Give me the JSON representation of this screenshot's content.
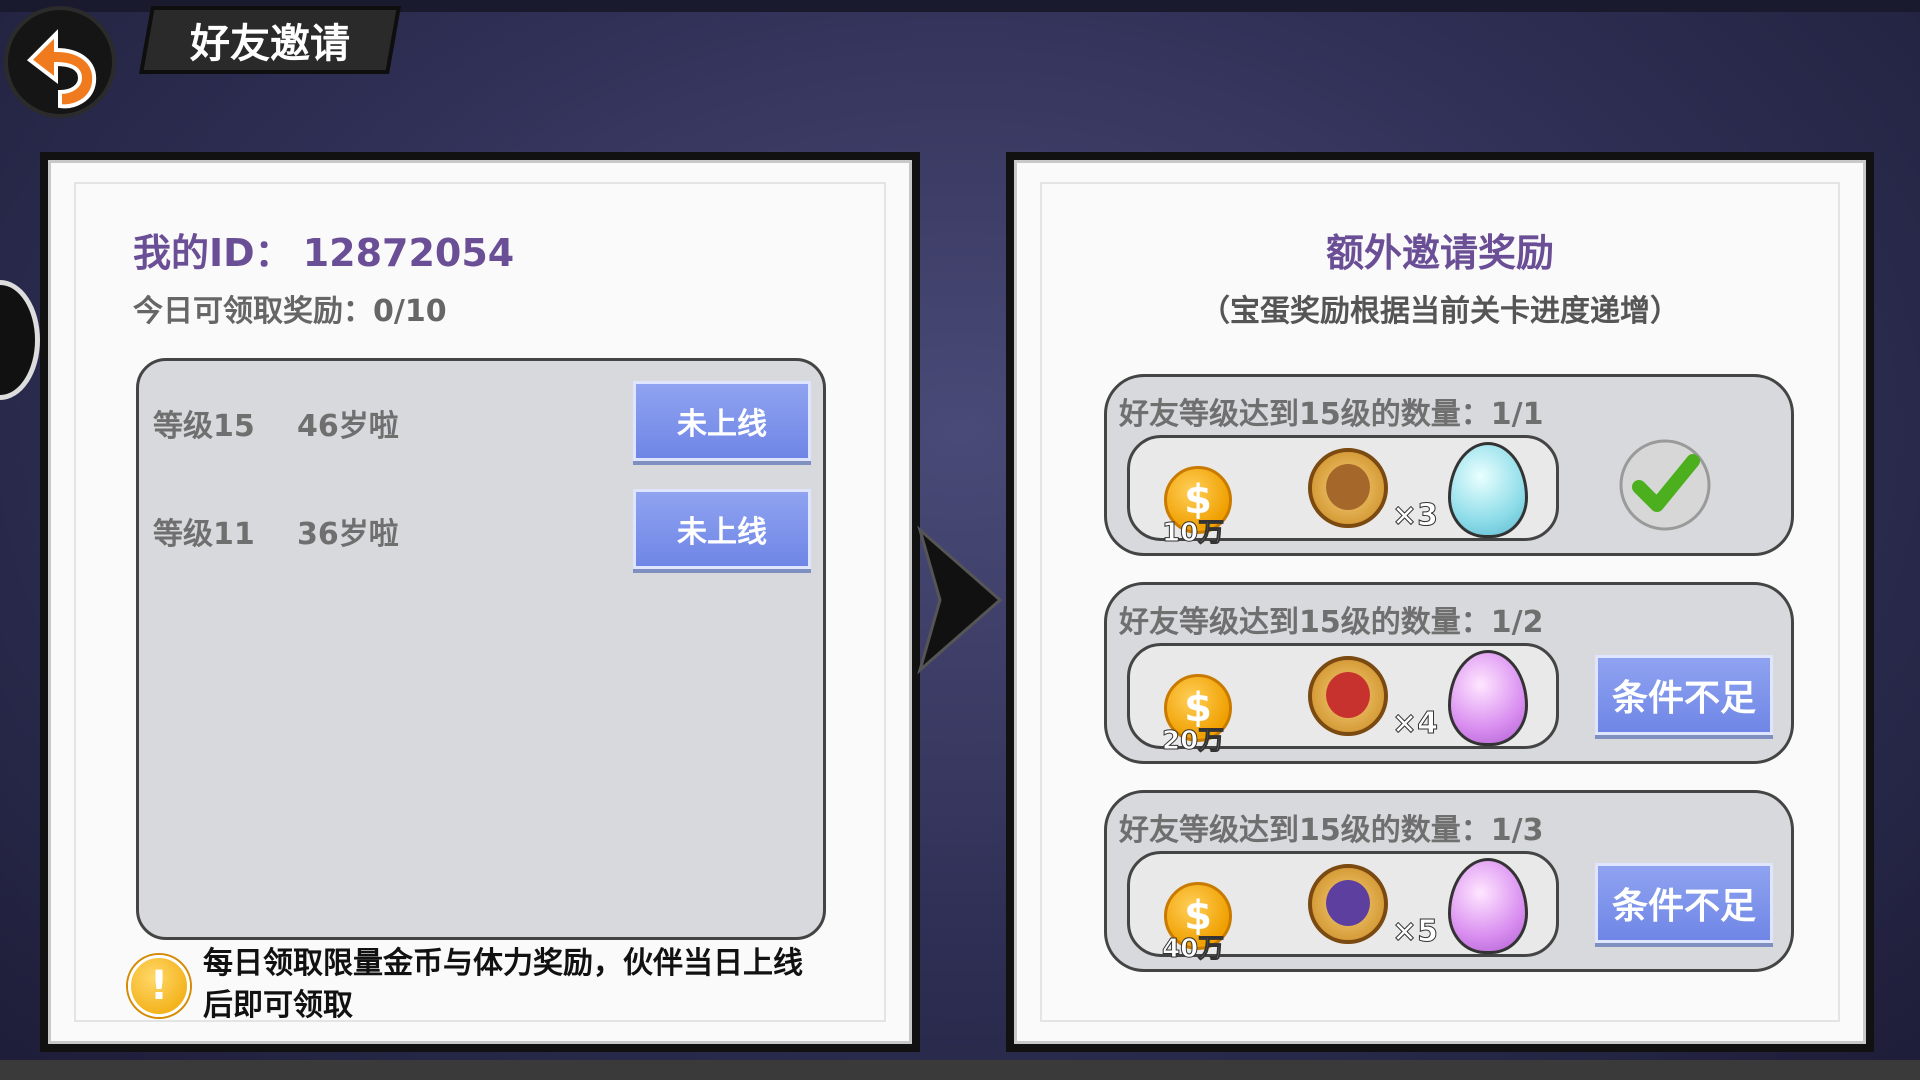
{
  "header": {
    "title": "好友邀请"
  },
  "left_panel": {
    "my_id_label": "我的ID：",
    "my_id_value": "12872054",
    "daily_reward": "今日可领取奖励：0/10",
    "friends": [
      {
        "level": "等级15",
        "name": "46岁啦",
        "status": "未上线"
      },
      {
        "level": "等级11",
        "name": "36岁啦",
        "status": "未上线"
      }
    ],
    "tip_symbol": "!",
    "tip_text": "每日领取限量金币与体力奖励，伙伴当日上线后即可领取"
  },
  "right_panel": {
    "title": "额外邀请奖励",
    "subtitle": "（宝蛋奖励根据当前关卡进度递增）",
    "coin_symbol": "$",
    "rewards": [
      {
        "condition": "好友等级达到15级的数量：1/1",
        "coins": "10万",
        "hero_qty": "×3",
        "egg": "blue",
        "state": "completed"
      },
      {
        "condition": "好友等级达到15级的数量：1/2",
        "coins": "20万",
        "hero_qty": "×4",
        "egg": "purple",
        "state": "条件不足"
      },
      {
        "condition": "好友等级达到15级的数量：1/3",
        "coins": "40万",
        "hero_qty": "×5",
        "egg": "purple",
        "state": "条件不足"
      }
    ]
  },
  "colors": {
    "title_purple": "#6a4e96",
    "button_blue": "#7b90ea",
    "coin_gold": "#f0a000",
    "check_green": "#4caf1e"
  },
  "icons": {
    "back": "back-arrow-icon",
    "tip": "warning-icon",
    "check": "checkmark-icon",
    "arrow": "chevron-right-icon"
  }
}
